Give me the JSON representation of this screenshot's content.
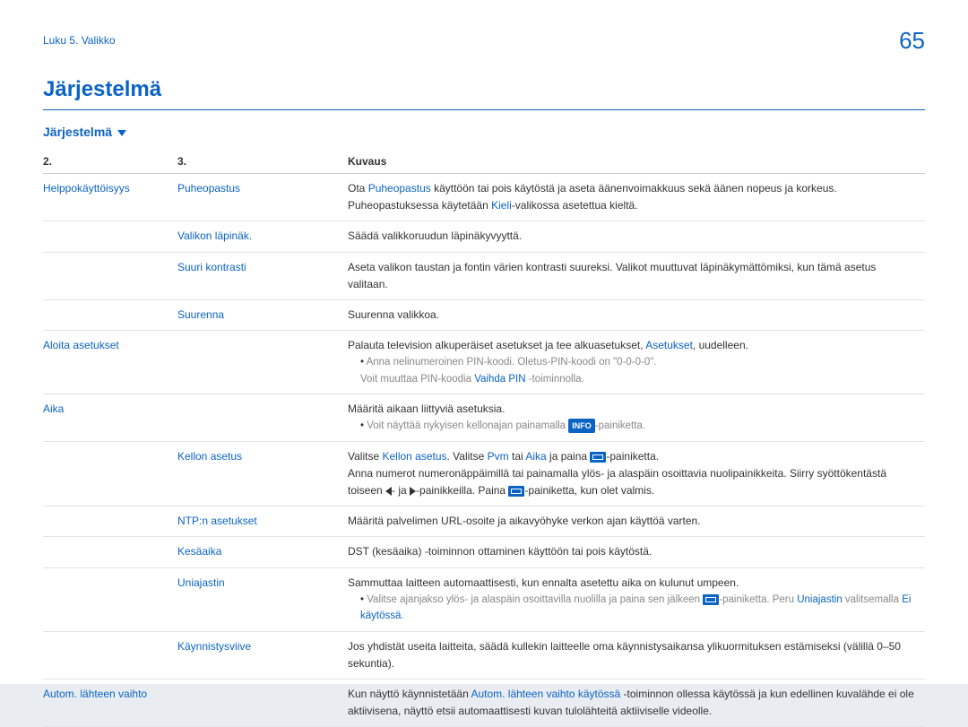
{
  "breadcrumb": "Luku 5. Valikko",
  "page_number": "65",
  "title": "Järjestelmä",
  "section": "Järjestelmä",
  "headers": {
    "c2": "2.",
    "c3": "3.",
    "desc": "Kuvaus"
  },
  "rows": [
    {
      "c2": "Helppokäyttöisyys",
      "c3": "Puheopastus",
      "desc_pre": "Ota ",
      "l1": "Puheopastus",
      "desc_mid": " käyttöön tai pois käytöstä ja aseta äänenvoimakkuus sekä äänen nopeus ja korkeus. Puheopastuksessa käytetään ",
      "l2": "Kieli",
      "desc_post": "-valikossa asetettua kieltä."
    },
    {
      "c3": "Valikon läpinäk.",
      "desc": "Säädä valikkoruudun läpinäkyvyyttä."
    },
    {
      "c3": "Suuri kontrasti",
      "desc": "Aseta valikon taustan ja fontin värien kontrasti suureksi. Valikot muuttuvat läpinäkymättömiksi, kun tämä asetus valitaan."
    },
    {
      "c3": "Suurenna",
      "desc": "Suurenna valikkoa."
    },
    {
      "c2": "Aloita asetukset",
      "desc_pre": "Palauta television alkuperäiset asetukset ja tee alkuasetukset, ",
      "l1": "Asetukset",
      "desc_post": ", uudelleen.",
      "bullet": "Anna nelinumeroinen PIN-koodi. Oletus-PIN-koodi on \"0-0-0-0\".",
      "bullet2_pre": "Voit muuttaa PIN-koodia ",
      "bl": "Vaihda PIN",
      "bullet2_post": " -toiminnolla."
    },
    {
      "c2": "Aika",
      "desc": "Määritä aikaan liittyviä asetuksia.",
      "bullet_pre": "Voit näyttää nykyisen kellonajan painamalla ",
      "badge": "INFO",
      "bullet_post": "-painiketta."
    },
    {
      "c3": "Kellon asetus",
      "p1_pre": "Valitse ",
      "p1_l1": "Kellon asetus",
      "p1_mid": ". Valitse ",
      "p1_l2": "Pvm",
      "p1_mid2": " tai ",
      "p1_l3": "Aika",
      "p1_mid3": " ja paina ",
      "p1_post": "-painiketta.",
      "p2_pre": "Anna numerot numeronäppäimillä tai painamalla ylös- ja alaspäin osoittavia nuolipainikkeita. Siirry syöttökentästä toiseen ",
      "p2_mid": "- ja ",
      "p2_mid2": "-painikkeilla. Paina ",
      "p2_post": "-painiketta, kun olet valmis."
    },
    {
      "c3": "NTP:n asetukset",
      "desc": "Määritä palvelimen URL-osoite ja aikavyöhyke verkon ajan käyttöä varten."
    },
    {
      "c3": "Kesäaika",
      "desc": "DST (kesäaika) -toiminnon ottaminen käyttöön tai pois käytöstä."
    },
    {
      "c3": "Uniajastin",
      "desc": "Sammuttaa laitteen automaattisesti, kun ennalta asetettu aika on kulunut umpeen.",
      "bul_pre": "Valitse ajanjakso ylös- ja alaspäin osoittavilla nuolilla ja paina sen jälkeen ",
      "bul_mid": "-painiketta. Peru ",
      "bl1": "Uniajastin",
      "bul_mid2": " valitsemalla ",
      "bl2": "Ei käytössä",
      "bul_post": "."
    },
    {
      "c3": "Käynnistysviive",
      "desc": "Jos yhdistät useita laitteita, säädä kullekin laitteelle oma käynnistysaikansa ylikuormituksen estämiseksi (välillä 0–50 sekuntia)."
    },
    {
      "c2": "Autom. lähteen vaihto",
      "desc_pre": "Kun näyttö käynnistetään ",
      "l1": "Autom. lähteen vaihto käytössä",
      "desc_post": " -toiminnon ollessa käytössä ja kun edellinen kuvalähde ei ole aktiivisena, näyttö etsii automaattisesti kuvan tulolähteitä aktiiviselle videolle."
    }
  ]
}
